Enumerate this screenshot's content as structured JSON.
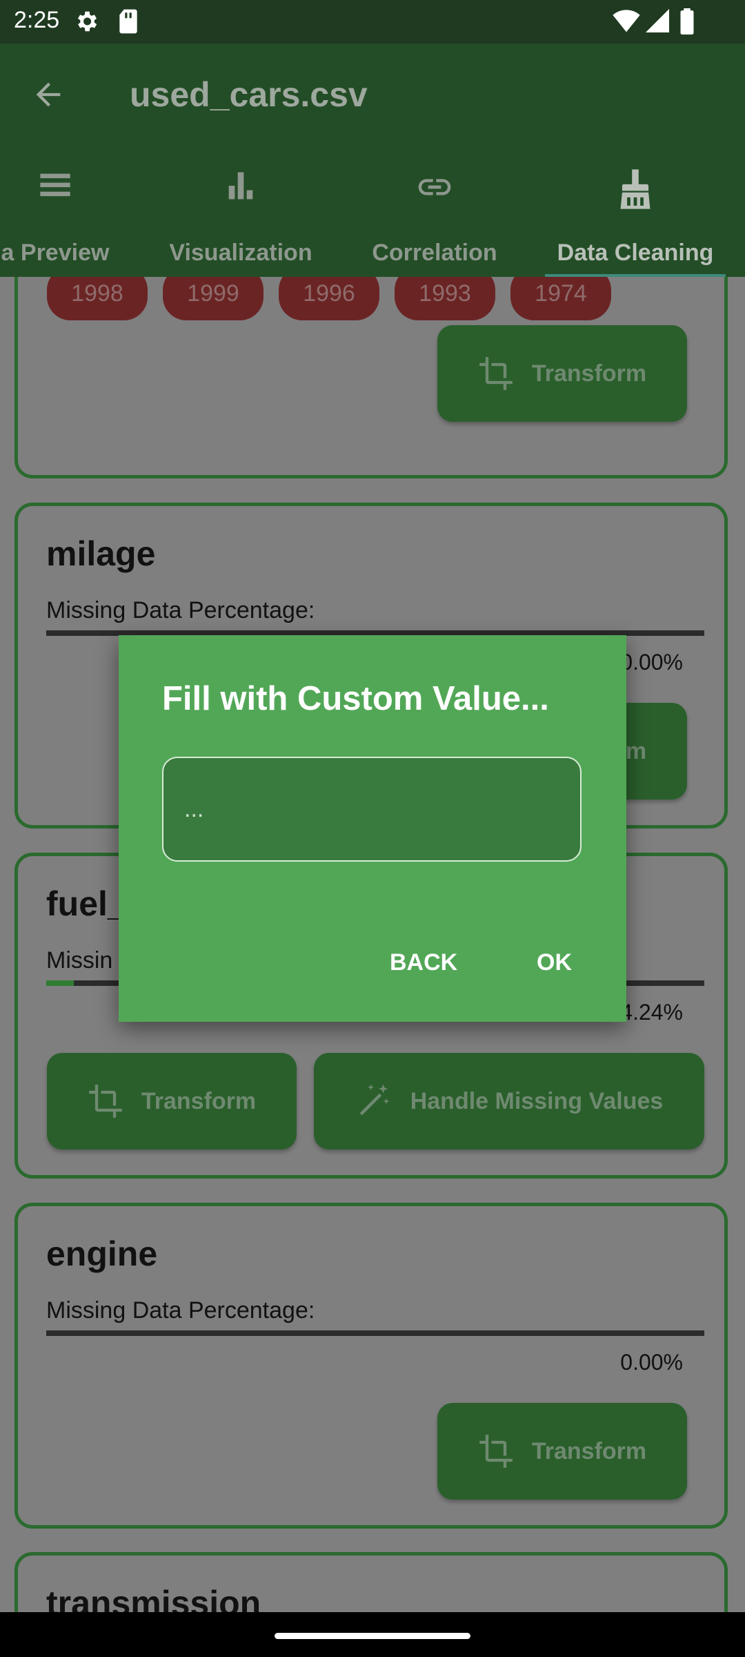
{
  "status_bar": {
    "time": "2:25"
  },
  "app_bar": {
    "title": "used_cars.csv"
  },
  "tabs": [
    {
      "label": "a Preview",
      "icon": "list-icon"
    },
    {
      "label": "Visualization",
      "icon": "bar-chart-icon"
    },
    {
      "label": "Correlation",
      "icon": "link-icon"
    },
    {
      "label": "Data Cleaning",
      "icon": "broom-icon",
      "active": true
    }
  ],
  "year_chips": [
    "1998",
    "1999",
    "1996",
    "1993",
    "1974"
  ],
  "cards": [
    {
      "transform_label": "Transform"
    },
    {
      "name": "milage",
      "missing_label": "Missing Data Percentage:",
      "percentage": "0.00%",
      "fill_fraction": 0.0,
      "transform_label": "Transform"
    },
    {
      "name": "fuel_",
      "missing_label": "Missin",
      "percentage": "4.24%",
      "fill_fraction": 0.0424,
      "transform_label": "Transform",
      "handle_label": "Handle Missing Values"
    },
    {
      "name": "engine",
      "missing_label": "Missing Data Percentage:",
      "percentage": "0.00%",
      "fill_fraction": 0.0,
      "transform_label": "Transform"
    },
    {
      "name": "transmission"
    }
  ],
  "dialog": {
    "title": "Fill with Custom Value...",
    "input_placeholder": "...",
    "back_label": "BACK",
    "ok_label": "OK"
  },
  "colors": {
    "primary": "#2e7d32",
    "dialog": "#52a757",
    "chip": "#6b2424"
  }
}
